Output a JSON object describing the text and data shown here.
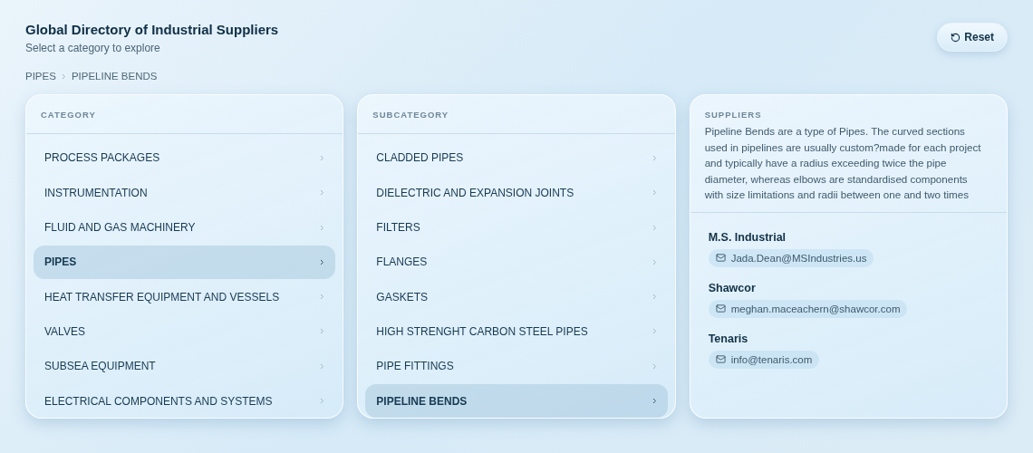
{
  "header": {
    "title": "Global Directory of Industrial Suppliers",
    "subtitle": "Select a category to explore",
    "reset_button": "Reset"
  },
  "breadcrumb": [
    "PIPES",
    "PIPELINE BENDS"
  ],
  "category_panel": {
    "heading": "CATEGORY",
    "items": [
      {
        "label": "PROCESS PACKAGES",
        "selected": false
      },
      {
        "label": "INSTRUMENTATION",
        "selected": false
      },
      {
        "label": "FLUID AND GAS MACHINERY",
        "selected": false
      },
      {
        "label": "PIPES",
        "selected": true
      },
      {
        "label": "HEAT TRANSFER EQUIPMENT AND VESSELS",
        "selected": false
      },
      {
        "label": "VALVES",
        "selected": false
      },
      {
        "label": "SUBSEA EQUIPMENT",
        "selected": false
      },
      {
        "label": "ELECTRICAL COMPONENTS AND SYSTEMS",
        "selected": false
      }
    ]
  },
  "subcategory_panel": {
    "heading": "SUBCATEGORY",
    "items": [
      {
        "label": "CLADDED PIPES",
        "selected": false
      },
      {
        "label": "DIELECTRIC AND EXPANSION JOINTS",
        "selected": false
      },
      {
        "label": "FILTERS",
        "selected": false
      },
      {
        "label": "FLANGES",
        "selected": false
      },
      {
        "label": "GASKETS",
        "selected": false
      },
      {
        "label": "HIGH STRENGHT CARBON STEEL PIPES",
        "selected": false
      },
      {
        "label": "PIPE FITTINGS",
        "selected": false
      },
      {
        "label": "PIPELINE BENDS",
        "selected": true
      }
    ]
  },
  "suppliers_panel": {
    "heading": "SUPPLIERS",
    "description": "Pipeline Bends are a type of Pipes. The curved sections used in pipelines are usually custom?made for each project and typically have a radius exceeding twice the pipe diameter, whereas elbows are standardised components with size limitations and radii between one and two times",
    "suppliers": [
      {
        "name": "M.S. Industrial",
        "email": "Jada.Dean@MSIndustries.us"
      },
      {
        "name": "Shawcor",
        "email": "meghan.maceachern@shawcor.com"
      },
      {
        "name": "Tenaris",
        "email": "info@tenaris.com"
      }
    ]
  }
}
